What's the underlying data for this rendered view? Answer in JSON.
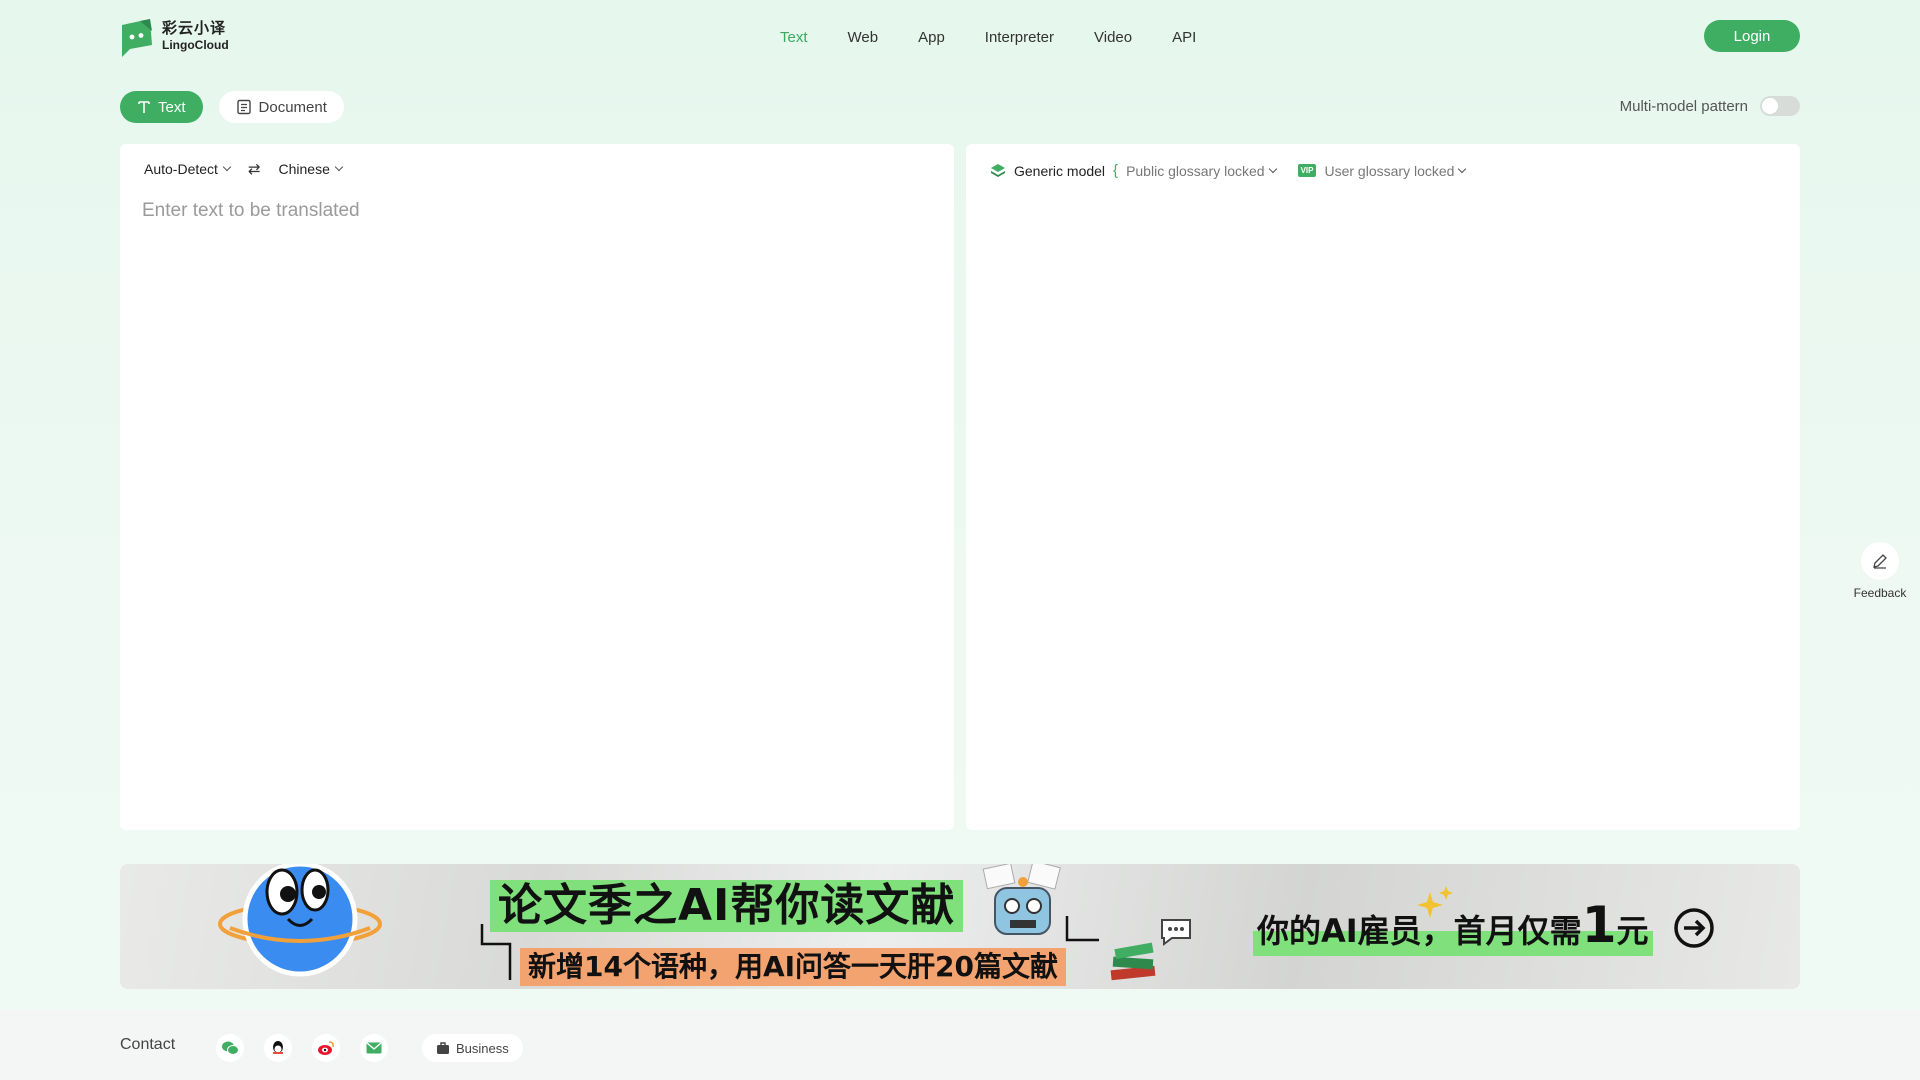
{
  "logo": {
    "cn": "彩云小译",
    "en": "LingoCloud"
  },
  "nav": [
    {
      "label": "Text",
      "active": true
    },
    {
      "label": "Web"
    },
    {
      "label": "App"
    },
    {
      "label": "Interpreter"
    },
    {
      "label": "Video"
    },
    {
      "label": "API"
    }
  ],
  "login_label": "Login",
  "modes": {
    "text": "Text",
    "document": "Document"
  },
  "multi_model": {
    "label": "Multi-model pattern",
    "enabled": false
  },
  "source": {
    "from_lang": "Auto-Detect",
    "to_lang": "Chinese",
    "placeholder": "Enter text to be translated"
  },
  "target": {
    "model": "Generic model",
    "public_glossary": "Public glossary locked",
    "vip_badge": "VIP",
    "user_glossary": "User glossary locked"
  },
  "feedback_label": "Feedback",
  "banner": {
    "title": "论文季之AI帮你读文献",
    "subtitle": "新增14个语种，用AI问答一天肝20篇文献",
    "right_prefix": "你的AI雇员，首月仅需",
    "right_big": "1",
    "right_suffix": "元"
  },
  "footer": {
    "contact": "Contact",
    "business": "Business"
  },
  "colors": {
    "accent": "#3fae62",
    "banner_green": "#7fe07c",
    "banner_orange": "#f3a36f"
  }
}
